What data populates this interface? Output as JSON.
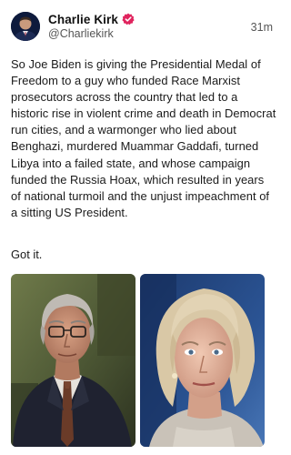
{
  "author": {
    "display_name": "Charlie Kirk",
    "handle": "@Charliekirk",
    "verified_badge": "verified-icon",
    "avatar": "profile-avatar"
  },
  "post": {
    "timestamp": "31m",
    "body": "So Joe Biden is giving the Presidential Medal of Freedom to a guy who funded Race Marxist prosecutors across the country that led to a historic rise in violent crime and death in Democrat run cities, and a warmonger who lied about Benghazi, murdered Muammar Gaddafi, turned Libya into a failed state, and whose campaign funded the Russia Hoax, which resulted in years of national turmoil and the unjust impeachment of a sitting US President.",
    "closing": "Got it."
  },
  "media": {
    "images": [
      {
        "name": "photo-older-man-in-suit"
      },
      {
        "name": "photo-woman-portrait"
      }
    ]
  },
  "colors": {
    "verified_badge": "#e0245e",
    "handle_text": "#555555",
    "background": "#ffffff"
  }
}
